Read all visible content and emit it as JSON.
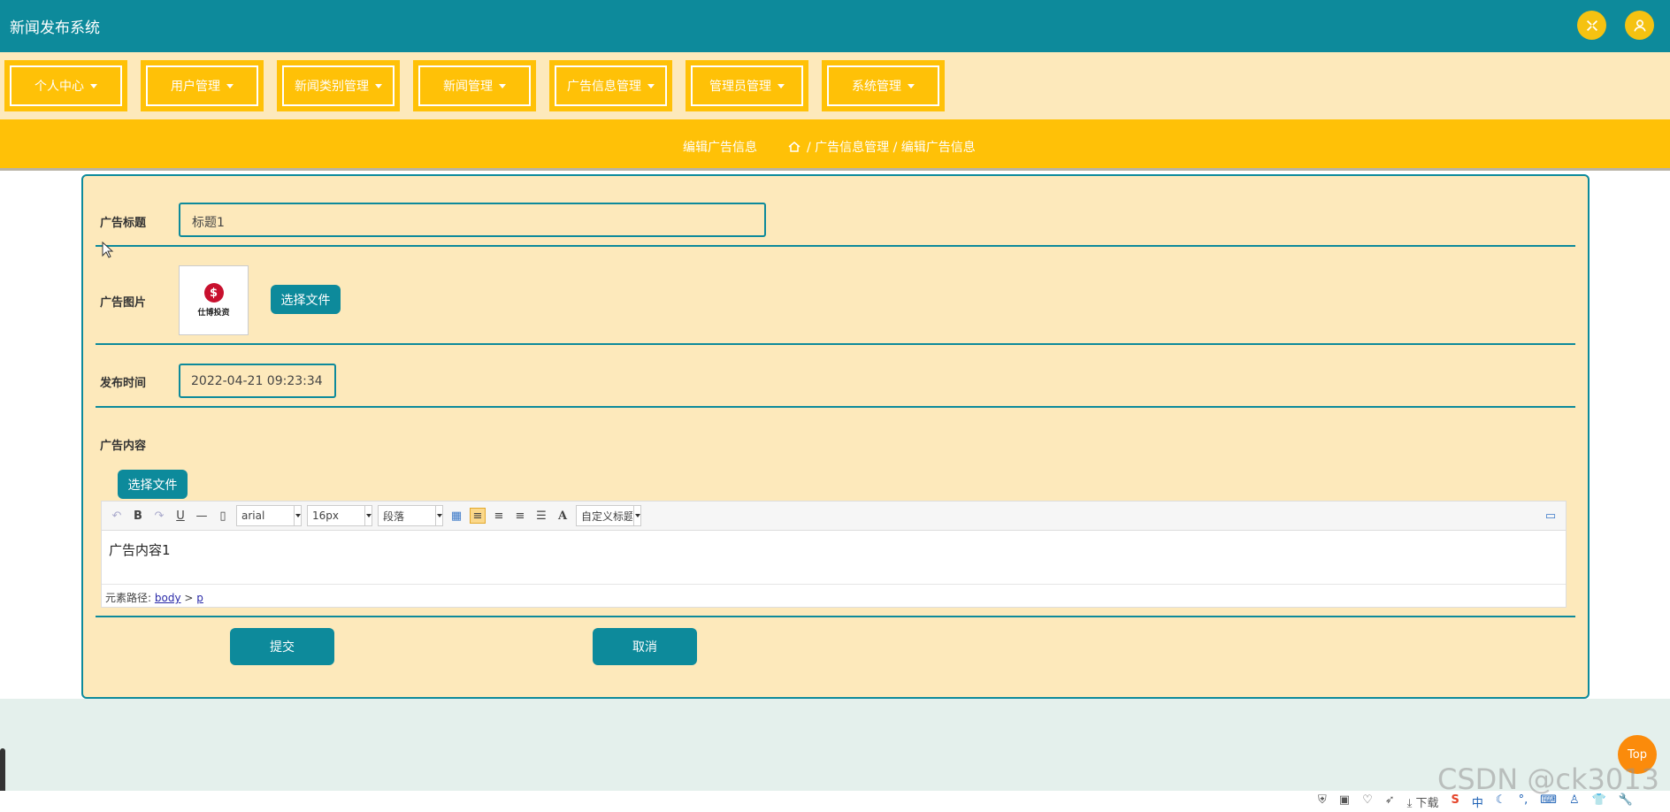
{
  "app": {
    "title": "新闻发布系统"
  },
  "header": {
    "fullscreen_icon": "fullscreen-icon",
    "user_icon": "user-icon"
  },
  "nav": {
    "items": [
      {
        "label": "个人中心"
      },
      {
        "label": "用户管理"
      },
      {
        "label": "新闻类别管理"
      },
      {
        "label": "新闻管理"
      },
      {
        "label": "广告信息管理"
      },
      {
        "label": "管理员管理"
      },
      {
        "label": "系统管理"
      }
    ]
  },
  "breadcrumb": {
    "page_title": "编辑广告信息",
    "path": "/ 广告信息管理 / 编辑广告信息"
  },
  "form": {
    "title_label": "广告标题",
    "title_value": "标题1",
    "image_label": "广告图片",
    "image_logo_text": "仕博投资",
    "choose_file": "选择文件",
    "time_label": "发布时间",
    "time_value": "2022-04-21 09:23:34",
    "content_label": "广告内容",
    "content_choose_file": "选择文件",
    "editor": {
      "font": "arial",
      "size": "16px",
      "paragraph": "段落",
      "custom_title": "自定义标题",
      "body_text": "广告内容1",
      "path_label": "元素路径:",
      "path_body": "body",
      "path_sep": ">",
      "path_p": "p"
    },
    "submit": "提交",
    "cancel": "取消"
  },
  "floating": {
    "top": "Top"
  },
  "watermark": "CSDN @ck3013",
  "statusbar": {
    "download": "下载",
    "ime": "中"
  },
  "colors": {
    "teal": "#0d8a9b",
    "gold": "#ffc107",
    "cream": "#fde9bb"
  }
}
